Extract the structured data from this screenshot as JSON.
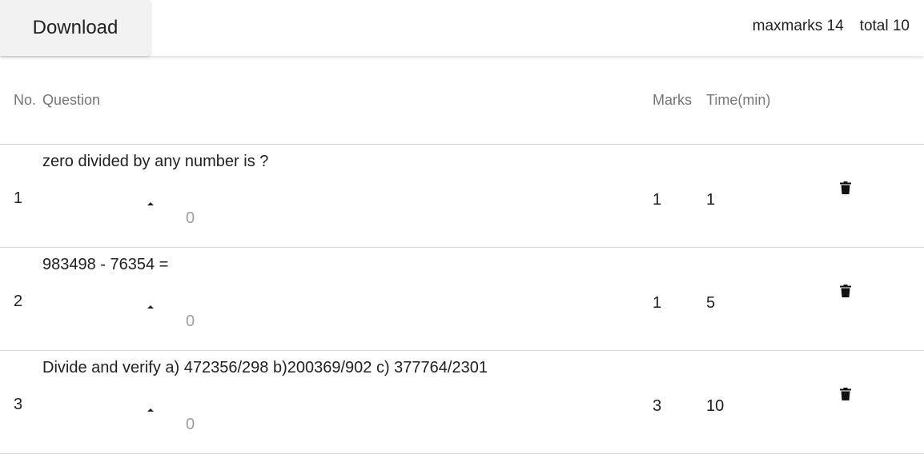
{
  "toolbar": {
    "download_label": "Download"
  },
  "stats": {
    "maxmarks_text": "maxmarks 14",
    "total_text": "total 10"
  },
  "table": {
    "headers": {
      "no": "No.",
      "question": "Question",
      "marks": "Marks",
      "time": "Time(min)"
    },
    "rows": [
      {
        "no": "1",
        "question": "zero divided by any number is ?",
        "count": "0",
        "marks": "1",
        "time": "1"
      },
      {
        "no": "2",
        "question": "983498 - 76354 =",
        "count": "0",
        "marks": "1",
        "time": "5"
      },
      {
        "no": "3",
        "question": "Divide and verify a) 472356/298 b)200369/902 c) 377764/2301",
        "count": "0",
        "marks": "3",
        "time": "10"
      }
    ]
  },
  "icons": {
    "expand": "caret-up-icon",
    "delete": "trash-icon"
  }
}
